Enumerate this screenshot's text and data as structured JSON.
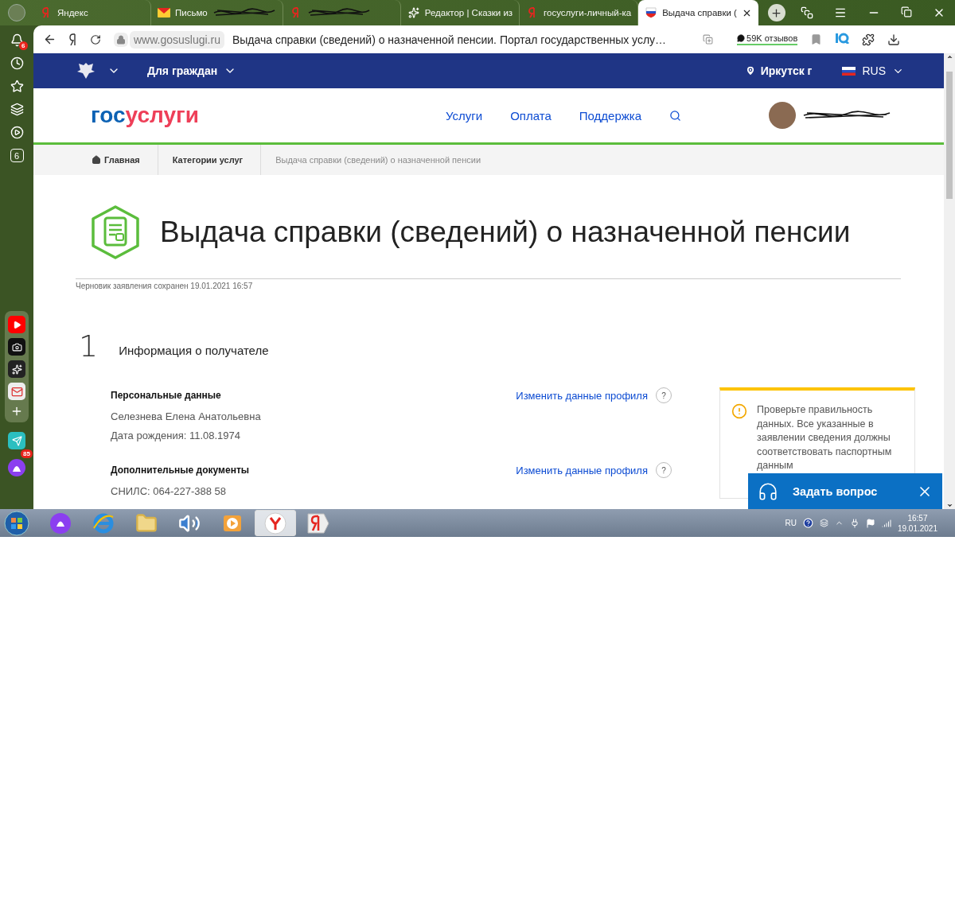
{
  "browser": {
    "tabs": [
      {
        "kind": "yandex",
        "title": "Яндекс",
        "selected": false
      },
      {
        "kind": "mail",
        "title": "Письмо",
        "scribbled": true,
        "selected": false
      },
      {
        "kind": "yandex",
        "scribbled": true,
        "selected": false
      },
      {
        "kind": "star",
        "title": "Редактор | Сказки из",
        "selected": false
      },
      {
        "kind": "yandex",
        "title": "госуслуги-личный-ка",
        "selected": false
      },
      {
        "kind": "gov",
        "title": "Выдача справки (",
        "selected": true
      }
    ],
    "address": {
      "domain": "www.gosuslugi.ru",
      "title": "Выдача справки (сведений) о назначенной пенсии. Портал государственных услу…"
    },
    "reviews": "59K отзывов",
    "sidebar": {
      "notifications_badge": "6",
      "tab_count": "6",
      "apps": [
        {
          "kind": "video"
        },
        {
          "kind": "camera"
        },
        {
          "kind": "star"
        },
        {
          "kind": "mail"
        }
      ],
      "messenger_badge": "85"
    }
  },
  "topbar": {
    "menu": "Для граждан",
    "city": "Иркутск г",
    "language": "RUS"
  },
  "header": {
    "logo": {
      "first": "гос",
      "second": "услуги"
    },
    "nav": [
      "Услуги",
      "Оплата",
      "Поддержка"
    ]
  },
  "breadcrumbs": [
    {
      "label": "Главная",
      "current": false
    },
    {
      "label": "Категории услуг",
      "current": false
    },
    {
      "label": "Выдача справки (сведений) о назначенной пенсии",
      "current": true
    }
  ],
  "page": {
    "title": "Выдача справки (сведений) о назначенной пенсии",
    "draft_note": "Черновик заявления сохранен 19.01.2021 16:57"
  },
  "step": {
    "number": "1",
    "title": "Информация о получателе",
    "groups": [
      {
        "title": "Персональные данные",
        "link": "Изменить данные профиля",
        "help": "?",
        "lines": [
          "Селезнева Елена Анатольевна",
          "Дата рождения: 11.08.1974"
        ]
      },
      {
        "title": "Дополнительные документы",
        "link": "Изменить данные профиля",
        "help": "?",
        "lines": [
          "СНИЛС: 064-227-388 58"
        ]
      }
    ]
  },
  "notice": {
    "text": "Проверьте правильность данных. Все указанные в заявлении сведения должны соответствовать паспортным данным"
  },
  "chat": {
    "label": "Задать вопрос"
  },
  "taskbar": {
    "apps": [
      {
        "kind": "alice",
        "selected": false
      },
      {
        "kind": "ie",
        "selected": false
      },
      {
        "kind": "folder",
        "selected": false
      },
      {
        "kind": "speaker",
        "selected": false
      },
      {
        "kind": "media",
        "selected": false
      },
      {
        "kind": "yandex-browser",
        "selected": true
      },
      {
        "kind": "yandex",
        "selected": false
      }
    ],
    "language": "RU",
    "time": "16:57",
    "date": "19.01.2021"
  }
}
